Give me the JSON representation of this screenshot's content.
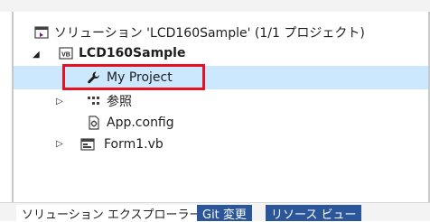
{
  "solution": {
    "label": "ソリューション 'LCD160Sample' (1/1 プロジェクト)",
    "icon": "solution-icon"
  },
  "project": {
    "label": "LCD160Sample",
    "icon": "vb-project-icon",
    "expanded": true
  },
  "items": [
    {
      "label": "My Project",
      "icon": "wrench-icon",
      "selected": true,
      "expandable": false
    },
    {
      "label": "参照",
      "icon": "references-icon",
      "selected": false,
      "expandable": true
    },
    {
      "label": "App.config",
      "icon": "config-file-icon",
      "selected": false,
      "expandable": false
    },
    {
      "label": "Form1.vb",
      "icon": "form-file-icon",
      "selected": false,
      "expandable": true
    }
  ],
  "tabs": [
    {
      "label": "ソリューション エクスプローラー",
      "active": true
    },
    {
      "label": "Git 変更",
      "active": false
    },
    {
      "label": "リソース ビュー",
      "active": false
    }
  ],
  "colors": {
    "selection": "#cce8ff",
    "highlight": "#e81123",
    "tab_inactive": "#2b579a"
  }
}
